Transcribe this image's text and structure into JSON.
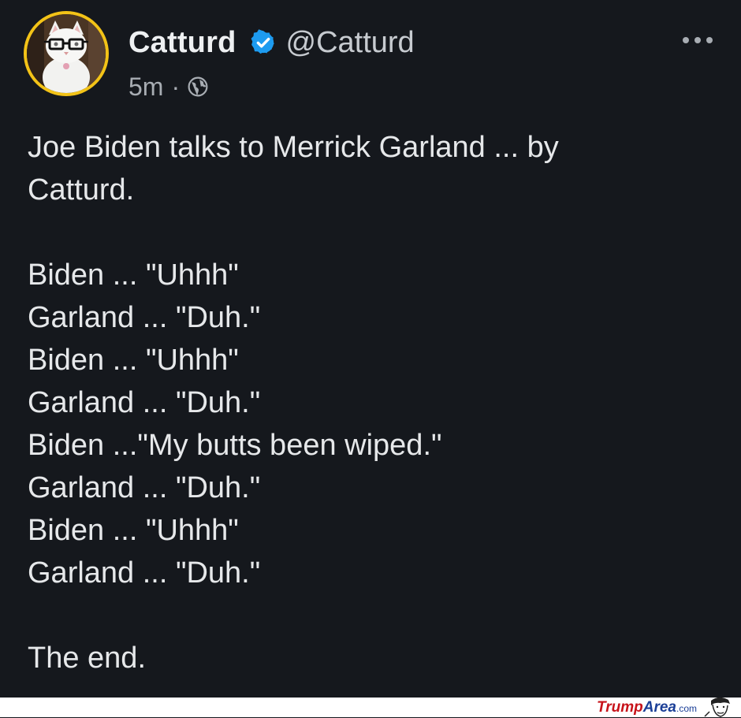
{
  "post": {
    "display_name": "Catturd",
    "handle": "@Catturd",
    "time": "5m",
    "separator": "·",
    "visibility_icon": "globe-icon",
    "verified_icon": "verified-badge-icon",
    "more_icon": "more-options-icon",
    "text": {
      "intro_line1": "Joe Biden talks to Merrick Garland ... by",
      "intro_line2": "Catturd.",
      "dialogue": [
        "Biden ... \"Uhhh\"",
        "Garland ... \"Duh.\"",
        "Biden ... \"Uhhh\"",
        "Garland ... \"Duh.\"",
        "Biden ...\"My butts been wiped.\"",
        "Garland ... \"Duh.\"",
        "Biden ... \"Uhhh\"",
        "Garland ... \"Duh.\""
      ],
      "ending": "The end."
    }
  },
  "watermark": {
    "part1": "Trump",
    "part2": "Area",
    "part3": ".com"
  },
  "colors": {
    "background": "#15181d",
    "text": "#e6e8ea",
    "secondary": "#a8adb3",
    "verified": "#1d9bf0",
    "avatar_ring": "#f3c317"
  }
}
